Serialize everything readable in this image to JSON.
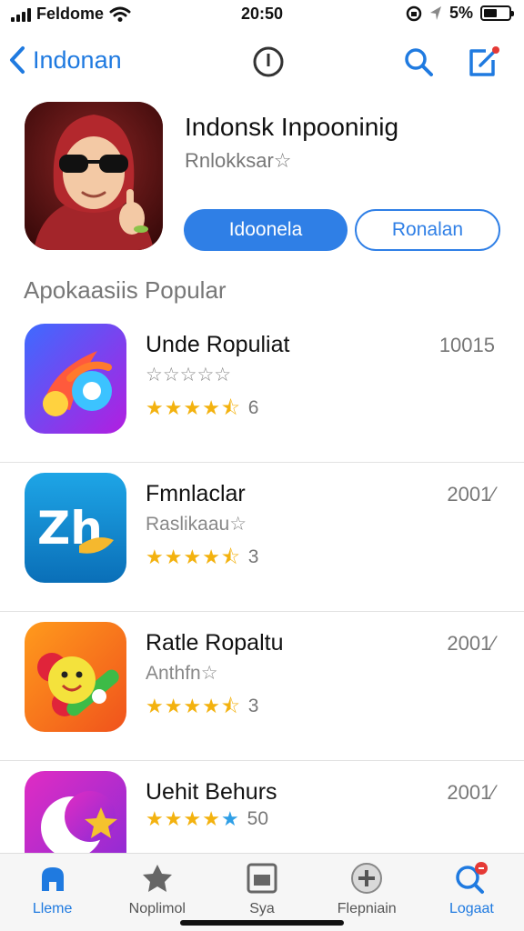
{
  "status": {
    "carrier": "Feldome",
    "time": "20:50",
    "battery": "5%",
    "battery_level": 0.55
  },
  "nav": {
    "back_label": "Indonan",
    "icons": [
      "chevron-left-icon",
      "info-icon",
      "search-icon",
      "compose-icon"
    ]
  },
  "featured": {
    "title": "Indonsk Inpooninig",
    "subtitle": "Rnlokksar☆",
    "primary_button": "Idoonela",
    "secondary_button": "Ronalan"
  },
  "section": {
    "title": "Apokaasiis Popular"
  },
  "apps": [
    {
      "name": "Unde Ropuliat",
      "year": "10015",
      "subtitle": "☆☆☆☆☆",
      "stars": [
        "full",
        "full",
        "full",
        "full",
        "half"
      ],
      "count": "6",
      "icon": "music-note-icon"
    },
    {
      "name": "Fmnlaclar",
      "year": "2001⁄",
      "subtitle": "Raslikaau☆",
      "stars": [
        "full",
        "full",
        "full",
        "full",
        "half"
      ],
      "count": "3",
      "icon": "zh-letters-icon"
    },
    {
      "name": "Ratle Ropaltu",
      "year": "2001⁄",
      "subtitle": "Anthfn☆",
      "stars": [
        "full",
        "full",
        "full",
        "full",
        "half"
      ],
      "count": "3",
      "icon": "smiley-flower-icon"
    },
    {
      "name": "Uehit Behurs",
      "year": "2001⁄",
      "subtitle": "",
      "stars": [
        "full",
        "full",
        "full",
        "full",
        "blue"
      ],
      "count": "50",
      "icon": "moon-star-icon"
    }
  ],
  "tabs": [
    {
      "label": "Lleme",
      "icon": "home-icon",
      "active": true
    },
    {
      "label": "Noplimol",
      "icon": "star-icon",
      "active": false
    },
    {
      "label": "Sya",
      "icon": "window-icon",
      "active": false
    },
    {
      "label": "Flepniain",
      "icon": "plus-circle-icon",
      "active": false
    },
    {
      "label": "Logaat",
      "icon": "search-icon",
      "active": true
    }
  ],
  "colors": {
    "accent": "#2f7fe6",
    "star": "#f3b20f"
  }
}
